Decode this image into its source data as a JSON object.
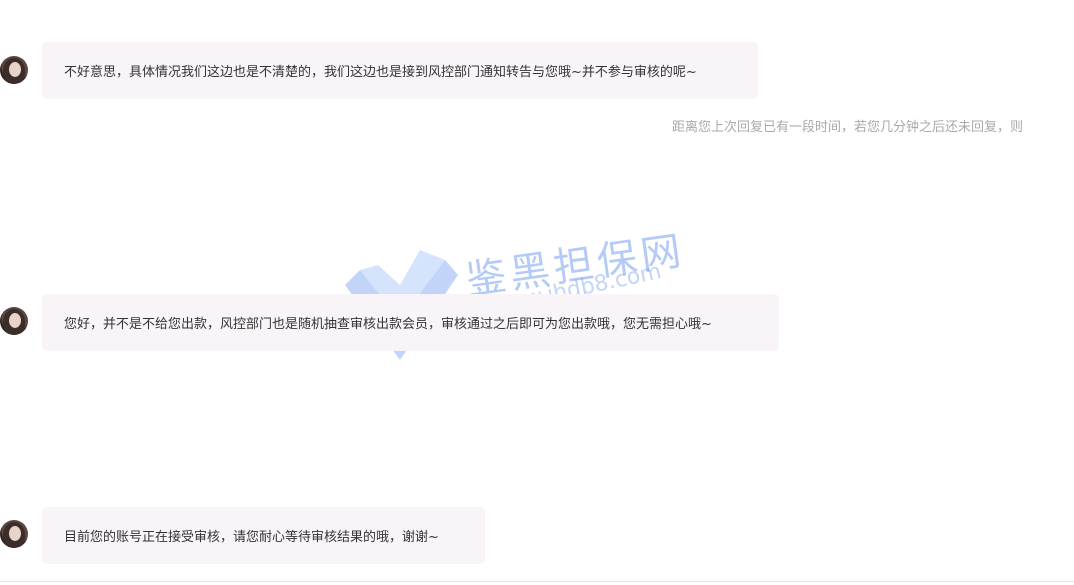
{
  "messages": [
    {
      "sender": "agent",
      "text": "不好意思，具体情况我们这边也是不清楚的，我们这边也是接到风控部门通知转告与您哦~并不参与审核的呢~"
    },
    {
      "sender": "agent",
      "text": "您好，并不是不给您出款，风控部门也是随机抽查审核出款会员，审核通过之后即可为您出款哦，您无需担心哦~"
    },
    {
      "sender": "agent",
      "text": "目前您的账号正在接受审核，请您耐心等待审核结果的哦，谢谢~"
    }
  ],
  "system_notice": "距离您上次回复已有一段时间，若您几分钟之后还未回复，则",
  "watermark": {
    "brand": "鉴黑担保网",
    "url": "www.jhdb8.com",
    "logo_icon": "v-shield-logo",
    "color": "#78a0f0"
  },
  "colors": {
    "bubble_bg": "#f8f4f8",
    "text": "#333333",
    "notice_text": "#a9a9a9"
  }
}
